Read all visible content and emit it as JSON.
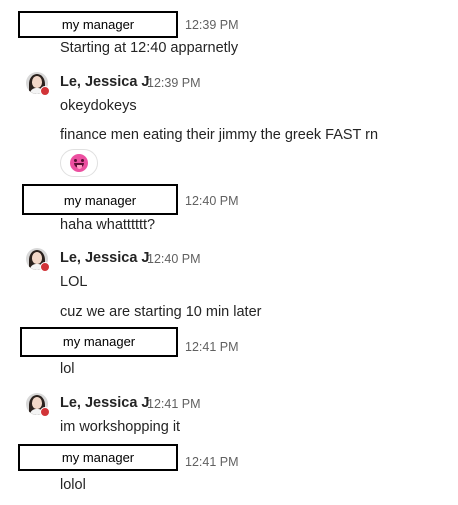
{
  "messages": [
    {
      "sender": "my manager",
      "time": "12:39 PM",
      "lines": [
        "Starting at 12:40 apparnetly"
      ]
    },
    {
      "sender": "Le, Jessica J",
      "time": "12:39 PM",
      "lines": [
        "okeydokeys",
        "finance men eating their jimmy the greek FAST rn"
      ],
      "reaction": "laughing-tongue-emoji"
    },
    {
      "sender": "my manager",
      "time": "12:40 PM",
      "lines": [
        "haha whatttttt?"
      ]
    },
    {
      "sender": "Le, Jessica J",
      "time": "12:40 PM",
      "lines": [
        "LOL",
        "cuz we are starting 10 min later"
      ]
    },
    {
      "sender": "my manager",
      "time": "12:41 PM",
      "lines": [
        "lol"
      ]
    },
    {
      "sender": "Le, Jessica J",
      "time": "12:41 PM",
      "lines": [
        "im workshopping it"
      ]
    },
    {
      "sender": "my manager",
      "time": "12:41 PM",
      "lines": [
        "lolol"
      ]
    }
  ],
  "colors": {
    "presence": "#d13438",
    "reaction_emoji": "#ec4fa0"
  }
}
